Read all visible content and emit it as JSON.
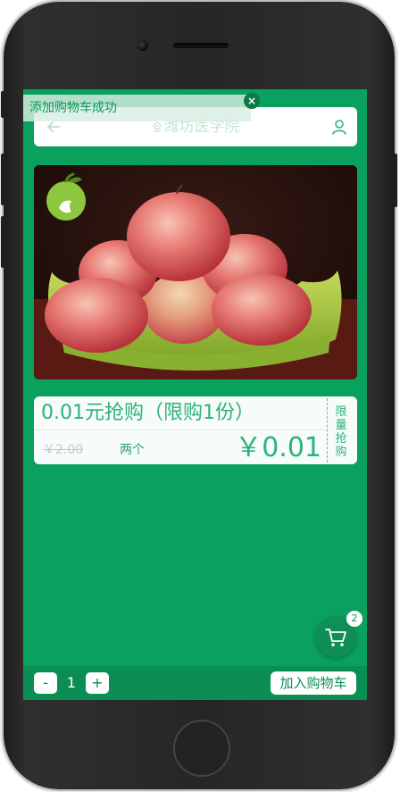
{
  "header": {
    "location": "潍坊医学院"
  },
  "toast": {
    "message": "添加购物车成功",
    "close": "×"
  },
  "product": {
    "promo_title": "0.01元抢购（限购1份）",
    "original_price": "￥2.00",
    "unit": "两个",
    "price": "￥0.01",
    "tag": "限量抢购"
  },
  "cart": {
    "count": "2"
  },
  "bottom": {
    "minus": "-",
    "quantity": "1",
    "plus": "+",
    "add_to_cart": "加入购物车"
  },
  "colors": {
    "brand": "#0aa05e",
    "bar": "#0b8e53",
    "accent_text": "#2bb37a"
  }
}
